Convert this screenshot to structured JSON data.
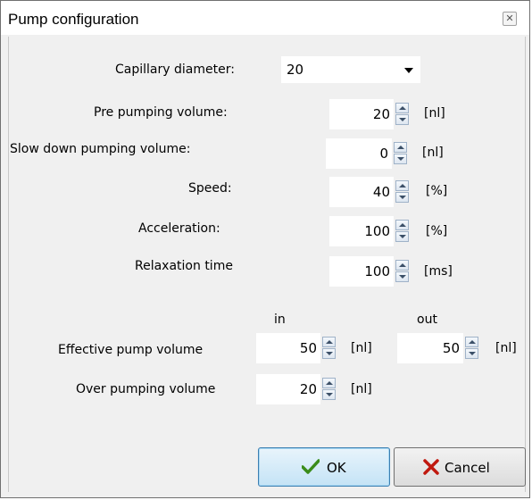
{
  "window": {
    "title": "Pump configuration"
  },
  "fields": {
    "capillary_diameter": {
      "label": "Capillary diameter:",
      "value": "20"
    },
    "pre_pumping": {
      "label": "Pre pumping volume:",
      "value": "20",
      "unit": "[nl]"
    },
    "slow_down": {
      "label": "Slow down pumping volume:",
      "value": "0",
      "unit": "[nl]"
    },
    "speed": {
      "label": "Speed:",
      "value": "40",
      "unit": "[%]"
    },
    "acceleration": {
      "label": "Acceleration:",
      "value": "100",
      "unit": "[%]"
    },
    "relaxation": {
      "label": "Relaxation time",
      "value": "100",
      "unit": "[ms]"
    }
  },
  "columns": {
    "in": "in",
    "out": "out"
  },
  "effective": {
    "label": "Effective pump volume",
    "in_value": "50",
    "in_unit": "[nl]",
    "out_value": "50",
    "out_unit": "[nl]"
  },
  "over_pumping": {
    "label": "Over pumping volume",
    "value": "20",
    "unit": "[nl]"
  },
  "buttons": {
    "ok": "OK",
    "cancel": "Cancel"
  },
  "icons": {
    "close": "close-icon",
    "ok": "checkmark-icon",
    "cancel": "x-icon"
  },
  "colors": {
    "check": "#3a8c1a",
    "x": "#c0190f"
  }
}
